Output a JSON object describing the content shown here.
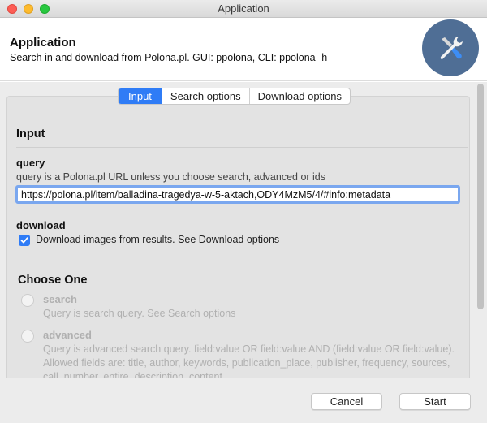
{
  "window": {
    "title": "Application"
  },
  "header": {
    "app_name": "Application",
    "description": "Search in and download from Polona.pl. GUI: ppolona, CLI: ppolona -h",
    "icon": "wrench-screwdriver-icon"
  },
  "tabs": [
    {
      "label": "Input",
      "active": true
    },
    {
      "label": "Search options",
      "active": false
    },
    {
      "label": "Download options",
      "active": false
    }
  ],
  "input_section": {
    "title": "Input",
    "query": {
      "label": "query",
      "help": "query is a Polona.pl URL unless you choose search, advanced or ids",
      "value": "https://polona.pl/item/balladina-tragedya-w-5-aktach,ODY4MzM5/4/#info:metadata"
    },
    "download": {
      "label": "download",
      "checkbox_label": "Download images from results. See Download options",
      "checked": true
    }
  },
  "choose_one": {
    "title": "Choose One",
    "options": [
      {
        "title": "search",
        "help": "Query is search query. See Search options"
      },
      {
        "title": "advanced",
        "help": "Query is advanced search query. field:value OR field:value AND (field:value OR field:value). Allowed fields are: title, author, keywords, publication_place, publisher, frequency, sources, call_number, entire_description, content"
      }
    ]
  },
  "footer": {
    "cancel_label": "Cancel",
    "start_label": "Start"
  },
  "colors": {
    "accent": "#2f7cf6",
    "icon_bg": "#4f6e95"
  }
}
